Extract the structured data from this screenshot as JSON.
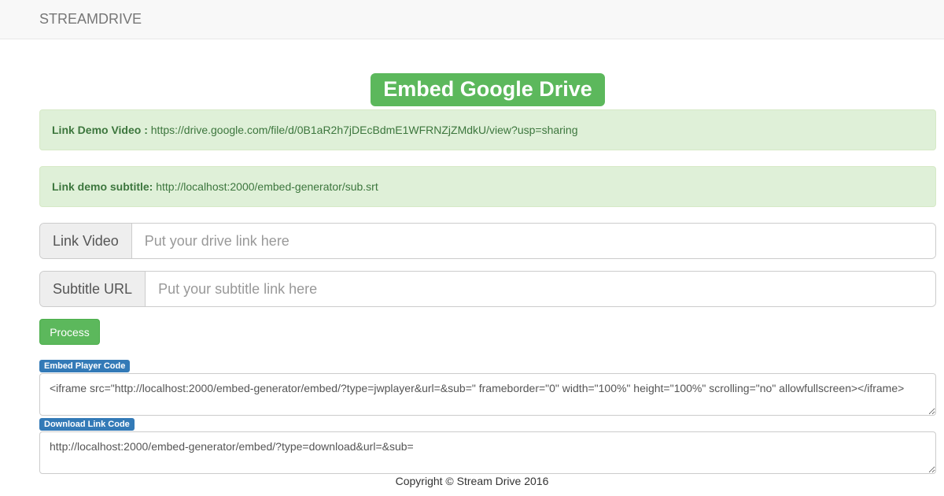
{
  "navbar": {
    "brand": "STREAMDRIVE"
  },
  "main": {
    "title": "Embed Google Drive",
    "demo_video": {
      "label": "Link Demo Video :",
      "value": "https://drive.google.com/file/d/0B1aR2h7jDEcBdmE1WFRNZjZMdkU/view?usp=sharing"
    },
    "demo_subtitle": {
      "label": "Link demo subtitle:",
      "value": "http://localhost:2000/embed-generator/sub.srt"
    },
    "link_video": {
      "label": "Link Video",
      "placeholder": "Put your drive link here",
      "value": ""
    },
    "subtitle_url": {
      "label": "Subtitle URL",
      "placeholder": "Put your subtitle link here",
      "value": ""
    },
    "process_label": "Process",
    "embed_code": {
      "label": "Embed Player Code",
      "value": "<iframe src=\"http://localhost:2000/embed-generator/embed/?type=jwplayer&url=&sub=\" frameborder=\"0\" width=\"100%\" height=\"100%\" scrolling=\"no\" allowfullscreen></iframe>"
    },
    "download_code": {
      "label": "Download Link Code",
      "value": "http://localhost:2000/embed-generator/embed/?type=download&url=&sub="
    }
  },
  "footer": {
    "text": "Copyright © Stream Drive 2016"
  },
  "colors": {
    "success": "#5cb85c",
    "alert_bg": "#dff0d8",
    "alert_text": "#3c763d",
    "label_primary": "#337ab7"
  }
}
